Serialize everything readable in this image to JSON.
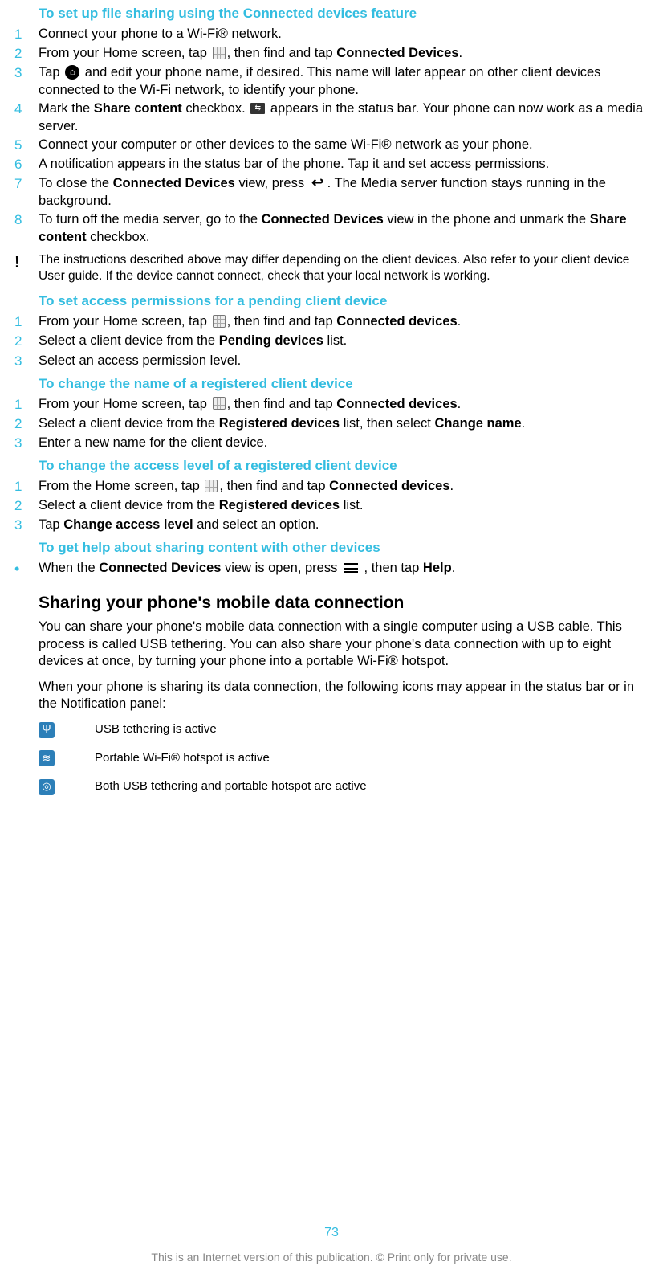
{
  "s1": {
    "title": "To set up file sharing using the Connected devices feature",
    "steps": [
      {
        "n": "1",
        "pre": "Connect your phone to a Wi-Fi® network."
      },
      {
        "n": "2",
        "pre": "From your Home screen, tap ",
        "icon": "grid",
        "mid": ", then find and tap ",
        "b1": "Connected Devices",
        "post": "."
      },
      {
        "n": "3",
        "pre": "Tap ",
        "icon": "home",
        "mid": " and edit your phone name, if desired. This name will later appear on other client devices connected to the Wi-Fi network, to identify your phone."
      },
      {
        "n": "4",
        "pre": "Mark the ",
        "b1": "Share content",
        "mid": " checkbox. ",
        "icon": "server",
        "post": " appears in the status bar. Your phone can now work as a media server."
      },
      {
        "n": "5",
        "pre": "Connect your computer or other devices to the same Wi-Fi® network as your phone."
      },
      {
        "n": "6",
        "pre": "A notification appears in the status bar of the phone. Tap it and set access permissions."
      },
      {
        "n": "7",
        "pre": "To close the ",
        "b1": "Connected Devices",
        "mid": " view, press ",
        "icon": "back",
        "post": ". The Media server function stays running in the background."
      },
      {
        "n": "8",
        "pre": "To turn off the media server, go to the ",
        "b1": "Connected Devices",
        "mid": " view in the phone and unmark the ",
        "b2": "Share content",
        "post": " checkbox."
      }
    ],
    "note": "The instructions described above may differ depending on the client devices. Also refer to your client device User guide. If the device cannot connect, check that your local network is working."
  },
  "s2": {
    "title": "To set access permissions for a pending client device",
    "steps": [
      {
        "n": "1",
        "pre": "From your Home screen, tap ",
        "icon": "grid",
        "mid": ", then find and tap ",
        "b1": "Connected devices",
        "post": "."
      },
      {
        "n": "2",
        "pre": "Select a client device from the ",
        "b1": "Pending devices",
        "post": " list."
      },
      {
        "n": "3",
        "pre": "Select an access permission level."
      }
    ]
  },
  "s3": {
    "title": "To change the name of a registered client device",
    "steps": [
      {
        "n": "1",
        "pre": "From your Home screen, tap ",
        "icon": "grid",
        "mid": ", then find and tap ",
        "b1": "Connected devices",
        "post": "."
      },
      {
        "n": "2",
        "pre": "Select a client device from the ",
        "b1": "Registered devices",
        "mid": " list, then select ",
        "b2": "Change name",
        "post": "."
      },
      {
        "n": "3",
        "pre": "Enter a new name for the client device."
      }
    ]
  },
  "s4": {
    "title": "To change the access level of a registered client device",
    "steps": [
      {
        "n": "1",
        "pre": "From the Home screen, tap ",
        "icon": "grid",
        "mid": ", then find and tap ",
        "b1": "Connected devices",
        "post": "."
      },
      {
        "n": "2",
        "pre": "Select a client device from the ",
        "b1": "Registered devices",
        "post": " list."
      },
      {
        "n": "3",
        "pre": "Tap ",
        "b1": "Change access level",
        "post": " and select an option."
      }
    ]
  },
  "s5": {
    "title": "To get help about sharing content with other devices",
    "bullet": {
      "pre": "When the ",
      "b1": "Connected Devices",
      "mid": " view is open, press ",
      "icon": "menu",
      "mid2": " , then tap ",
      "b2": "Help",
      "post": "."
    }
  },
  "sharing": {
    "heading": "Sharing your phone's mobile data connection",
    "p1": "You can share your phone's mobile data connection with a single computer using a USB cable. This process is called USB tethering. You can also share your phone's data connection with up to eight devices at once, by turning your phone into a portable Wi-Fi® hotspot.",
    "p2": "When your phone is sharing its data connection, the following icons may appear in the status bar or in the Notification panel:",
    "icons": [
      {
        "sym": "Ψ",
        "label": "USB tethering is active"
      },
      {
        "sym": "≋",
        "label": "Portable Wi-Fi® hotspot is active"
      },
      {
        "sym": "◎",
        "label": "Both USB tethering and portable hotspot are active"
      }
    ]
  },
  "footer": {
    "page": "73",
    "note": "This is an Internet version of this publication. © Print only for private use."
  }
}
